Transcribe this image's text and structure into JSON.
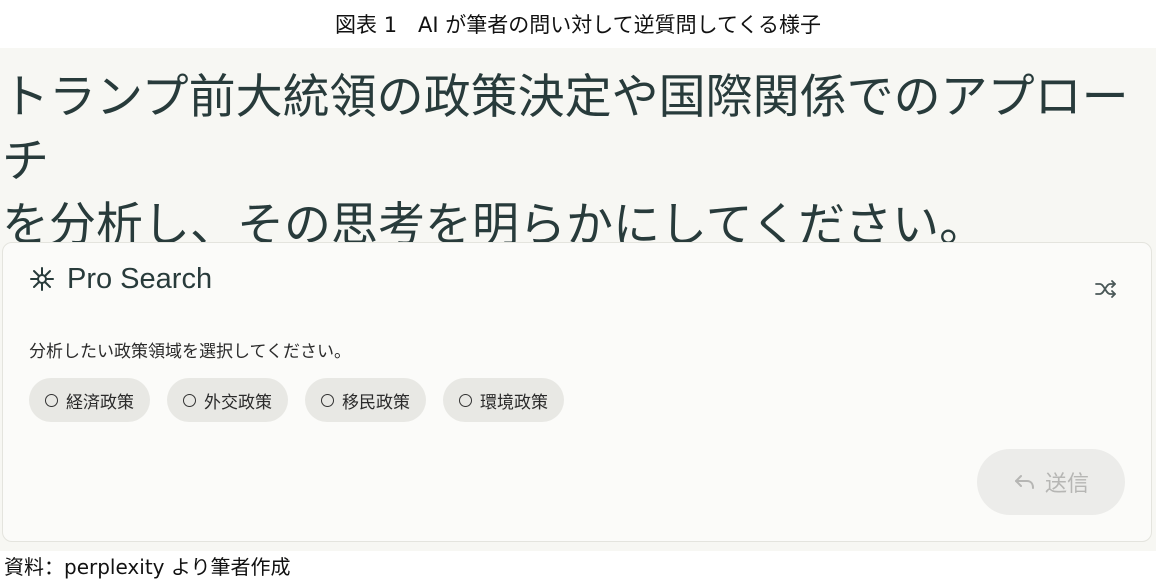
{
  "figure": {
    "caption": "図表 1　AI が筆者の問い対して逆質問してくる様子",
    "source": "資料：perplexity より筆者作成"
  },
  "query": {
    "line1": "トランプ前大統領の政策決定や国際関係でのアプローチ",
    "line2": "を分析し、その思考を明らかにしてください。"
  },
  "pro_search": {
    "title": "Pro Search",
    "icon": "sparkle-asterisk-icon",
    "shuffle_icon": "shuffle-icon",
    "prompt": "分析したい政策領域を選択してください。",
    "options": [
      {
        "label": "経済政策"
      },
      {
        "label": "外交政策"
      },
      {
        "label": "移民政策"
      },
      {
        "label": "環境政策"
      }
    ],
    "send_label": "送信",
    "send_icon": "reply-arrow-icon"
  },
  "colors": {
    "panel_bg": "#f7f7f3",
    "text_dark": "#283b3b",
    "pill_bg": "#e8e8e4",
    "send_disabled_text": "#b6b6b4"
  }
}
